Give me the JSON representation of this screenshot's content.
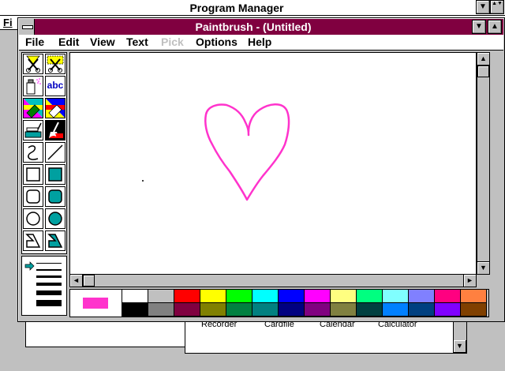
{
  "program_manager": {
    "title": "Program Manager",
    "menu_file": "Fi",
    "group_icons": [
      "Recorder",
      "Cardfile",
      "Calendar",
      "Calculator"
    ]
  },
  "paintbrush": {
    "title": "Paintbrush - (Untitled)",
    "menu": [
      "File",
      "Edit",
      "View",
      "Text",
      "Pick",
      "Options",
      "Help"
    ],
    "disabled_menu": [
      "Pick"
    ],
    "text_tool_label": "abc",
    "current_color": "#ff33cc",
    "drawing_color": "#ff33cc",
    "palette_top": [
      "#ffffff",
      "#c0c0c0",
      "#ff0000",
      "#ffff00",
      "#00ff00",
      "#00ffff",
      "#0000ff",
      "#ff00ff",
      "#ffff80",
      "#00ff80",
      "#80ffff",
      "#8080ff",
      "#ff0080",
      "#ff8040"
    ],
    "palette_bottom": [
      "#000000",
      "#808080",
      "#800040",
      "#808000",
      "#008040",
      "#008080",
      "#000080",
      "#800080",
      "#808040",
      "#004040",
      "#0080ff",
      "#004080",
      "#8000ff",
      "#804000"
    ]
  },
  "icons": {
    "scroll_up": "▲",
    "scroll_down": "▼",
    "scroll_left": "◄",
    "scroll_right": "►",
    "pm_minimize": "▼",
    "pm_maximize": "▲▼"
  }
}
